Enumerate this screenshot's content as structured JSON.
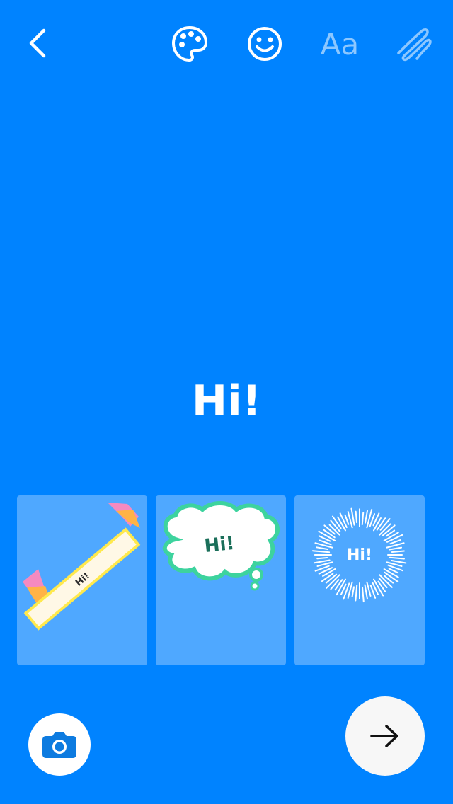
{
  "toolbar": {
    "back_icon": "chevron-left-icon",
    "palette_icon": "palette-icon",
    "emoji_icon": "smiley-icon",
    "text_label": "Aa",
    "draw_icon": "squiggle-pen-icon"
  },
  "canvas": {
    "text": "Hi!"
  },
  "stickers": [
    {
      "style": "ribbon-banner",
      "text": "Hi!"
    },
    {
      "style": "thought-cloud",
      "text": "Hi!"
    },
    {
      "style": "sunburst",
      "text": "Hi!"
    }
  ],
  "colors": {
    "background": "#0083FF",
    "card": "#4FA8FF",
    "cloud_outline": "#3DD39E",
    "cloud_text": "#1B6F5A"
  }
}
